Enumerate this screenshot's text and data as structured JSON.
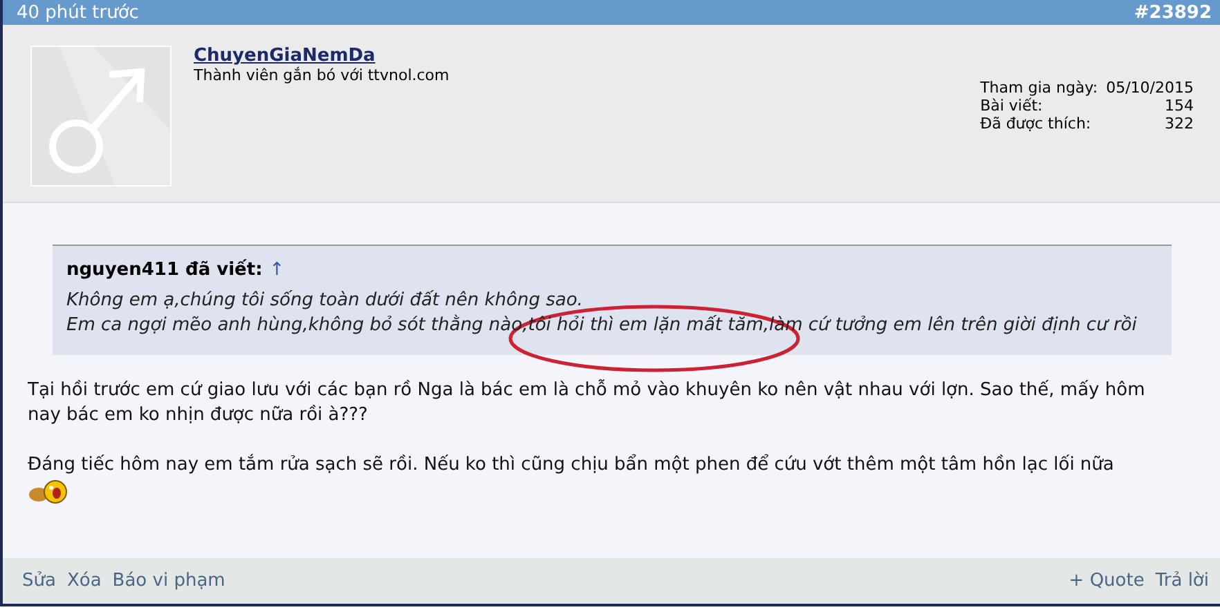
{
  "post_header": {
    "time": "40 phút trước",
    "post_number": "#23892"
  },
  "author": {
    "username": "ChuyenGiaNemDa",
    "title": "Thành viên gắn bó với ttvnol.com",
    "stats": [
      {
        "label": "Tham gia ngày:",
        "value": "05/10/2015"
      },
      {
        "label": "Bài viết:",
        "value": "154"
      },
      {
        "label": "Đã được thích:",
        "value": "322"
      }
    ]
  },
  "quote": {
    "author": "nguyen411 đã viết:",
    "link": "↑",
    "lines": [
      "Không em ạ,chúng tôi sống toàn dưới đất nên không sao.",
      "Em ca ngợi mẽo anh hùng,không bỏ sót thằng nào,tôi hỏi thì em lặn mất tăm,làm cứ tưởng em lên trên giời định cư rồi"
    ]
  },
  "body": {
    "paragraphs": [
      "Tại hồi trước em cứ giao lưu với các bạn rồ Nga là bác em là chỗ mỏ vào khuyên ko nên vật nhau với lợn. Sao thế, mấy hôm nay bác em ko nhịn được nữa rồi à???",
      "Đáng tiếc hôm nay em tắm rửa sạch sẽ rồi. Nếu ko thì cũng chịu bẩn một phen để cứu vớt thêm một tâm hồn lạc lối nữa"
    ]
  },
  "footer": {
    "left_links": [
      "Sửa",
      "Xóa",
      "Báo vi phạm"
    ],
    "right_links": [
      "+ Quote",
      "Trả lời"
    ]
  }
}
